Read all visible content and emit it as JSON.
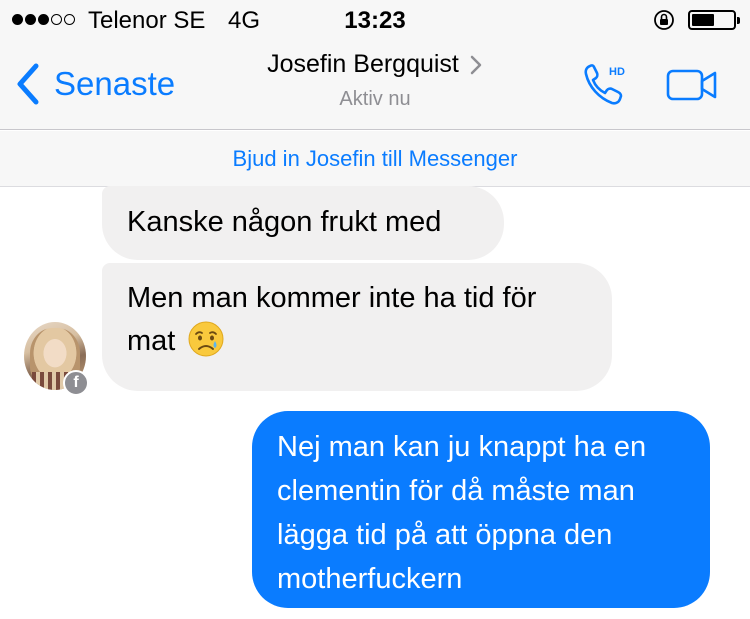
{
  "status_bar": {
    "carrier": "Telenor SE",
    "network": "4G",
    "time": "13:23",
    "signal_bars_filled": 3,
    "signal_bars_total": 5,
    "battery_level": 0.45
  },
  "nav": {
    "back_label": "Senaste",
    "contact_name": "Josefin Bergquist",
    "contact_status": "Aktiv nu",
    "call_badge": "HD"
  },
  "invite": {
    "label": "Bjud in Josefin till Messenger"
  },
  "messages": [
    {
      "direction": "incoming",
      "lines": [
        "Kanske någon frukt med"
      ]
    },
    {
      "direction": "incoming",
      "lines": [
        "Men man kommer inte ha tid för",
        "mat"
      ],
      "emoji": "😥"
    },
    {
      "direction": "outgoing",
      "lines": [
        "Nej man kan ju knappt ha en",
        "clementin för då måste man",
        "lägga tid på att öppna den",
        "motherfuckern"
      ]
    }
  ],
  "avatar": {
    "badge_glyph": "f"
  },
  "colors": {
    "accent": "#0a7cff",
    "incoming_bubble": "#f1f0f0",
    "outgoing_bubble": "#0a7cff",
    "bar_background": "#f7f7f7",
    "secondary_text": "#8e8e93"
  },
  "icons": {
    "back": "chevron-left-icon",
    "call": "phone-hd-icon",
    "video": "video-camera-icon",
    "rotation_lock": "rotation-lock-icon",
    "battery": "battery-icon",
    "facebook_badge": "facebook-icon"
  }
}
